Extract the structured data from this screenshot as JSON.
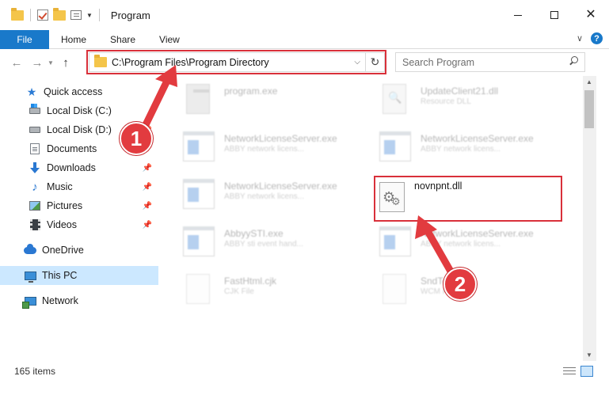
{
  "window": {
    "title": "Program"
  },
  "ribbon": {
    "file": "File",
    "home": "Home",
    "share": "Share",
    "view": "View"
  },
  "nav": {
    "address": "C:\\Program Files\\Program Directory",
    "search_placeholder": "Search Program"
  },
  "sidebar": {
    "items": [
      {
        "label": "Quick access",
        "icon": "star-icon"
      },
      {
        "label": "Local Disk (C:)",
        "icon": "local-disk-icon"
      },
      {
        "label": "Local Disk (D:)",
        "icon": "local-disk-icon"
      },
      {
        "label": "Documents",
        "icon": "documents-icon"
      },
      {
        "label": "Downloads",
        "icon": "downloads-icon"
      },
      {
        "label": "Music",
        "icon": "music-icon"
      },
      {
        "label": "Pictures",
        "icon": "pictures-icon"
      },
      {
        "label": "Videos",
        "icon": "videos-icon"
      },
      {
        "label": "OneDrive",
        "icon": "onedrive-icon"
      },
      {
        "label": "This PC",
        "icon": "this-pc-icon"
      },
      {
        "label": "Network",
        "icon": "network-icon"
      }
    ]
  },
  "files": [
    {
      "name": "program.exe",
      "type": ""
    },
    {
      "name": "UpdateClient21.dll",
      "type": "Resource DLL"
    },
    {
      "name": "NetworkLicenseServer.exe",
      "type": "ABBY network licens..."
    },
    {
      "name": "NetworkLicenseServer.exe",
      "type": "ABBY network licens..."
    },
    {
      "name": "NetworkLicenseServer.exe",
      "type": "ABBY network licens..."
    },
    {
      "name": "novnpnt.dll",
      "type": ""
    },
    {
      "name": "AbbyySTI.exe",
      "type": "ABBY sti event hand..."
    },
    {
      "name": "NetworkLicenseServer.exe",
      "type": "ABBY network licens..."
    },
    {
      "name": "FastHtml.cjk",
      "type": "CJK File"
    },
    {
      "name": "SndTo...wcm",
      "type": "WCM File"
    }
  ],
  "status": {
    "count": "165 items"
  },
  "annotations": {
    "badge1": "1",
    "badge2": "2"
  },
  "colors": {
    "accent": "#1979ca",
    "highlight": "#d9303a",
    "selected": "#cce8ff"
  }
}
